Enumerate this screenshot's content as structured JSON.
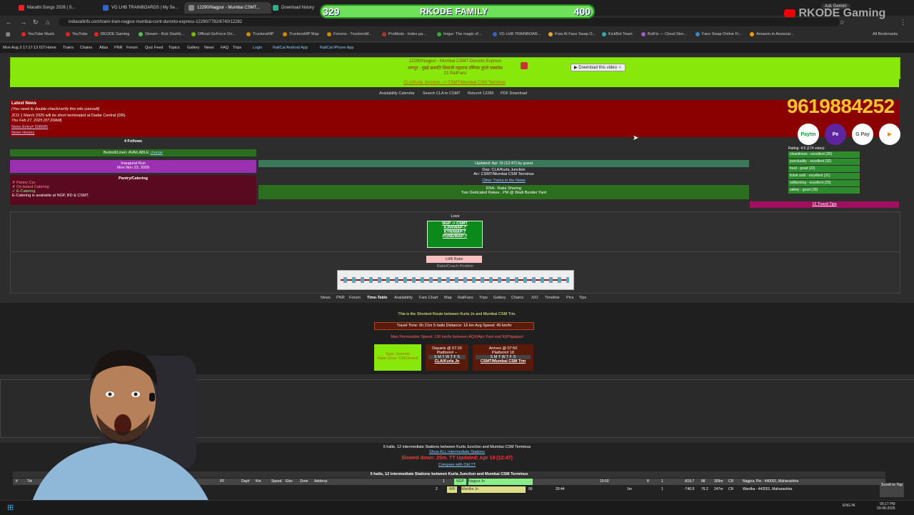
{
  "tabs": [
    {
      "label": "Marathi Songs 2026 | S...",
      "color": "#e22"
    },
    {
      "label": "VG LHB TRAINBOARDS | My Se...",
      "color": "#36c"
    },
    {
      "label": "12290/Nagpur - Mumbai CSMT...",
      "color": "#888"
    },
    {
      "label": "Download history",
      "color": "#3a8"
    }
  ],
  "url": "indiarailinfo.com/train/-train-nagpur-mumbai-csmt-duronto-express-12290/7782/6740/12282",
  "bookmarks": [
    "YouTube Music",
    "YouTube",
    "RKODE Gaming",
    "Stream - Kick Dashb...",
    "Official GeForce Dri...",
    "TruckersMP",
    "TruckersMP Map",
    "Forums - TruckersM...",
    "ProMods - Index pa...",
    "Imgur: The magic of...",
    "VG LHB TRAINBOAR...",
    "Free AI Face Swap O...",
    "KickBot Team",
    "BotFix — Cloud Stre...",
    "Face Swap Online Fr...",
    "Amazon.in Associat..."
  ],
  "all_bookmarks": "All Bookmarks",
  "ask_gemini": "Ask Gemini",
  "banner": {
    "left": "329",
    "name": "RKODE FAMILY",
    "right": "400"
  },
  "yt_overlay": "RKODE Gaming",
  "site_nav": [
    "Mon Aug 3 17:17:13 IST",
    "Home",
    "Trains",
    "Chains",
    "Atlas",
    "PNR",
    "Forum",
    "Quiz Feed",
    "Topics",
    "Gallery",
    "News",
    "FAQ",
    "Trips",
    "Login",
    "RailCal Android App",
    "RailCal iPhone App"
  ],
  "train": {
    "title": "12290/Nagpur - Mumbai CSMT Duronto Express",
    "hindi": "नागपुर - मुंबई छत्रपति शिवाजी महाराज टर्मिनस दुरंतो एक्सप्रेस",
    "railfans": "23 RailFans",
    "route_link": "CLA/Kurla Junction --> CSMT/Mumbai CSM Terminus",
    "download": "Download this video"
  },
  "links_row": [
    "Availability Calendar",
    "Search CLA to CSMT",
    "Return# 12289",
    "PDF Download"
  ],
  "news": {
    "heading": "Latest News",
    "note": "(You need to double-check/verify this info yourself)",
    "item": "JCO 1 March 2025 will be short terminated at Dadar Central (DR).",
    "date": "Thu Feb 27, 2025 (07:20AM)",
    "entry": "News Entry# 508685",
    "history": "News History"
  },
  "phone": "9619884252",
  "payments": [
    "Paytm",
    "Pe",
    "G Pay",
    "▶"
  ],
  "follows": "4 Follows",
  "bedroll": "Bedroll/Linen: AVAILABLE",
  "bedroll_link": "change",
  "inaugural": {
    "label": "Inaugural Run",
    "date": "Mon Nov 23, 2009"
  },
  "pantry": {
    "label": "Pantry/Catering",
    "items": [
      "✗ Pantry Car",
      "✗ On-board Catering",
      "✓ E-Catering",
      "E-Catering is available at NGP, BD & CSMT."
    ]
  },
  "updated": "Updated: Apr 19 (12:47) by guest",
  "dep": "Dep: CLA/Kurla Junction",
  "arr": "Arr: CSMT/Mumbai CSM Terminus",
  "other_trains": "Other Trains in the News",
  "rsa": {
    "label": "RSA - Rake Sharing",
    "text": "Two Dedicated Rakes . PM @ Wadi Bunder Yard"
  },
  "rating": {
    "label": "Rating: 4.5 (174 votes)",
    "items": [
      "cleanliness - excellent (30)",
      "punctuality - excellent (32)",
      "food - good (22)",
      "ticket avbl - excellent (31)",
      "railfanning - excellent (29)",
      "safety - good (30)"
    ]
  },
  "travel_tips": "12 Travel Tips",
  "loco": {
    "label": "Loco",
    "rows": [
      "NGP -> CSMT",
      "AJNI/WAP-7",
      "KYN/WAP-7",
      "PUNE/WAP-7"
    ]
  },
  "rake": {
    "label": "LHB Rake",
    "sub": "Rake/Coach Position"
  },
  "tabs2": [
    "News",
    "PNR",
    "Forum",
    "Time-Table",
    "Availability",
    "Fare Chart",
    "Map",
    "RailFans",
    "Trips",
    "Gallery",
    "Chains",
    "X/O",
    "Timeline",
    "Pics",
    "Tips"
  ],
  "route": {
    "shortest": "This is the Shortest Route between Kurla Jn and Mumbai CSM Trm.",
    "travel": "Travel Time: 0h 21m   5 halts   Distance: 16 km   Avg Speed: 45 km/hr",
    "maxspeed": "Max Permissible Speed: 130 km/hr between AQX/Ajni Yard and IGP/Igatpuri",
    "type": "Type: Duronto",
    "zone": "Rake Zone: CR/Central",
    "departs": "Departs @ 07:29",
    "dep_pf": "Platform# --",
    "dep_stn": "CLA/Kurla Jn",
    "arrives": "Arrives @ 07:50",
    "arr_pf": "Platform# 18",
    "arr_stn": "CSMT/Mumbai CSM Trm",
    "days": "S M T W T F S"
  },
  "halts": {
    "line1": "5 halts, 12 intermediate Stations between Kurla Junction and Mumbai CSM Terminus",
    "showall": "Show ALL Intermediate Stations",
    "slowed": "Slowed down: 25m.  TT Updated: Apr 19 (12:47)",
    "compare": "Compare with Old TT",
    "tablehdr": "5 halts, 12 intermediate Stations between Kurla Junction and Mumbai CSM Terminus",
    "cols": [
      "#",
      "Trk",
      "PF",
      "Day#",
      "Km",
      "Speed",
      "Elev",
      "Zone",
      "Address"
    ],
    "row1": [
      "1",
      "NGP",
      "Nagpur Jn",
      "19:50",
      "8",
      "1",
      "-819.7",
      "88",
      "309m",
      "CR",
      "Nagpur, Pin - 440001, Maharashtra"
    ],
    "row2": [
      "2",
      "WR",
      "Wardha Jn",
      "00",
      "20:44",
      "1m",
      "1",
      "-740.9",
      "76.2",
      "247m",
      "CR",
      "Wardha - 442001, Maharashtra"
    ]
  },
  "scroll_top": "Scroll to Top",
  "clock": {
    "time": "05:17 PM",
    "date": "03-08-2026",
    "lang": "ENG IN"
  }
}
